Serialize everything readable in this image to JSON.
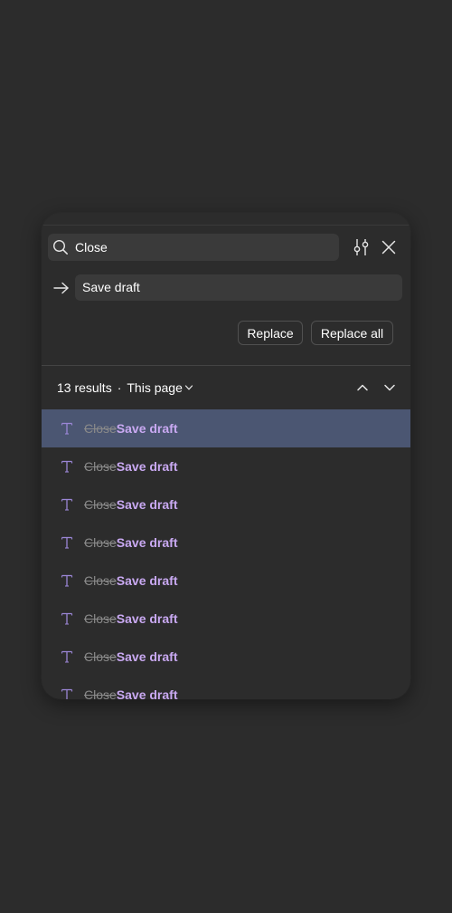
{
  "search": {
    "query": "Close",
    "replacement": "Save draft"
  },
  "actions": {
    "replace_label": "Replace",
    "replace_all_label": "Replace all"
  },
  "results": {
    "count_label": "13 results",
    "separator": "·",
    "scope_label": "This page",
    "items": [
      {
        "original": "Close",
        "replacement": "Save draft",
        "selected": true
      },
      {
        "original": "Close",
        "replacement": "Save draft",
        "selected": false
      },
      {
        "original": "Close",
        "replacement": "Save draft",
        "selected": false
      },
      {
        "original": "Close",
        "replacement": "Save draft",
        "selected": false
      },
      {
        "original": "Close",
        "replacement": "Save draft",
        "selected": false
      },
      {
        "original": "Close",
        "replacement": "Save draft",
        "selected": false
      },
      {
        "original": "Close",
        "replacement": "Save draft",
        "selected": false
      },
      {
        "original": "Close",
        "replacement": "Save draft",
        "selected": false
      }
    ]
  },
  "icons": {
    "search": "search-icon",
    "filter": "filter-sliders-icon",
    "close": "close-icon",
    "replace_arrow": "arrow-right-icon",
    "scope_caret": "chevron-down-icon",
    "prev": "chevron-up-icon",
    "next": "chevron-down-icon",
    "text_layer": "text-layer-icon"
  },
  "colors": {
    "background": "#2c2c2c",
    "field": "#3a3a3a",
    "selected_row": "#4b5672",
    "replacement_text": "#c9a9f2",
    "struck_text": "#8a8a8a",
    "type_icon": "#9b86d6"
  }
}
